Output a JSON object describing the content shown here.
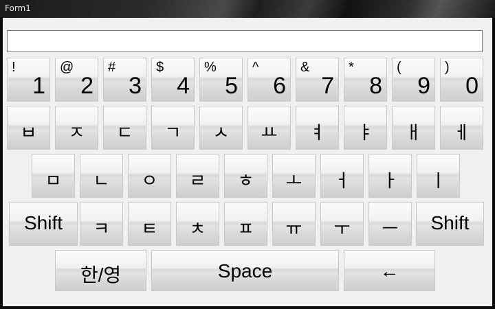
{
  "window": {
    "title": "Form1"
  },
  "textbox": {
    "value": ""
  },
  "row1": [
    {
      "shift": "!",
      "main": "1"
    },
    {
      "shift": "@",
      "main": "2"
    },
    {
      "shift": "#",
      "main": "3"
    },
    {
      "shift": "$",
      "main": "4"
    },
    {
      "shift": "%",
      "main": "5"
    },
    {
      "shift": "^",
      "main": "6"
    },
    {
      "shift": "&",
      "main": "7"
    },
    {
      "shift": "*",
      "main": "8"
    },
    {
      "shift": "(",
      "main": "9"
    },
    {
      "shift": ")",
      "main": "0"
    }
  ],
  "row2": [
    "ㅂ",
    "ㅈ",
    "ㄷ",
    "ㄱ",
    "ㅅ",
    "ㅛ",
    "ㅕ",
    "ㅑ",
    "ㅐ",
    "ㅔ"
  ],
  "row3": [
    "ㅁ",
    "ㄴ",
    "ㅇ",
    "ㄹ",
    "ㅎ",
    "ㅗ",
    "ㅓ",
    "ㅏ",
    "ㅣ"
  ],
  "row4": {
    "left_shift": "Shift",
    "keys": [
      "ㅋ",
      "ㅌ",
      "ㅊ",
      "ㅍ",
      "ㅠ",
      "ㅜ",
      "ㅡ"
    ],
    "right_shift": "Shift"
  },
  "row5": {
    "lang": "한/영",
    "space": "Space",
    "backspace": "←"
  }
}
